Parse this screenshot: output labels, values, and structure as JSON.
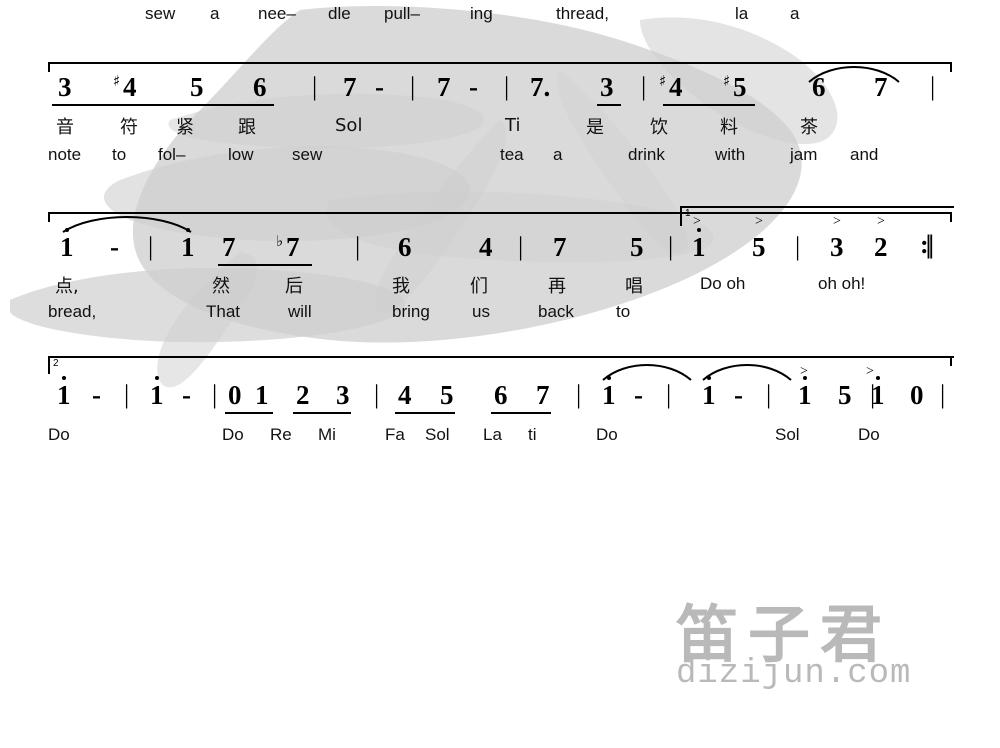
{
  "doc": {
    "type": "numbered-musical-notation",
    "title_watermark_cn": "笛子君",
    "title_watermark_en": "dizijun.com"
  },
  "line0": {
    "lyrics_en": [
      "sew",
      "a",
      "nee–",
      "dle",
      "pull–",
      "ing",
      "thread,",
      "la",
      "a"
    ]
  },
  "line1": {
    "notes": [
      "3",
      "4",
      "5",
      "6",
      "7",
      "-",
      "7",
      "-",
      "7.",
      "3",
      "4",
      "5",
      "6",
      "7"
    ],
    "accidentals": [
      "",
      "♯",
      "",
      "",
      "",
      "",
      "",
      "",
      "",
      "",
      "♯",
      "♯",
      "",
      ""
    ],
    "bars": [
      "|",
      "|",
      "|",
      "|",
      "|",
      "|"
    ],
    "lyrics_cn": [
      "音",
      "符",
      "紧",
      "跟",
      "Sol",
      "Ti",
      "是",
      "饮",
      "料",
      "茶"
    ],
    "lyrics_en": [
      "note",
      "to",
      "fol–",
      "low",
      "sew",
      "tea",
      "a",
      "drink",
      "with",
      "jam",
      "and"
    ]
  },
  "line2": {
    "notes": [
      "1",
      "-",
      "1",
      "7",
      "7",
      "6",
      "4",
      "7",
      "5",
      "1",
      "5",
      "3",
      "2"
    ],
    "accidentals": [
      "",
      "",
      "",
      "",
      "♭",
      "",
      "",
      "",
      "",
      "",
      "",
      "",
      ""
    ],
    "bars": [
      "|",
      "|",
      "|",
      "|",
      "|"
    ],
    "ending_number": "1",
    "repeat_end": ":||",
    "lyrics_cn": [
      "点,",
      "然",
      "后",
      "我",
      "们",
      "再",
      "唱",
      "Do oh",
      "oh oh!"
    ],
    "lyrics_en": [
      "bread,",
      "That",
      "will",
      "bring",
      "us",
      "back",
      "to"
    ]
  },
  "line3": {
    "ending_number": "2",
    "notes": [
      "1",
      "-",
      "1",
      "-",
      "0",
      "1",
      "2",
      "3",
      "4",
      "5",
      "6",
      "7",
      "1",
      "-",
      "1",
      "-",
      "1",
      "5",
      "1",
      "0"
    ],
    "bars": [
      "|",
      "|",
      "|",
      "|",
      "|",
      "|",
      "|",
      "|"
    ],
    "lyrics_en": [
      "Do",
      "Do",
      "Re",
      "Mi",
      "Fa",
      "Sol",
      "La",
      "ti",
      "Do",
      "Sol",
      "Do"
    ]
  }
}
